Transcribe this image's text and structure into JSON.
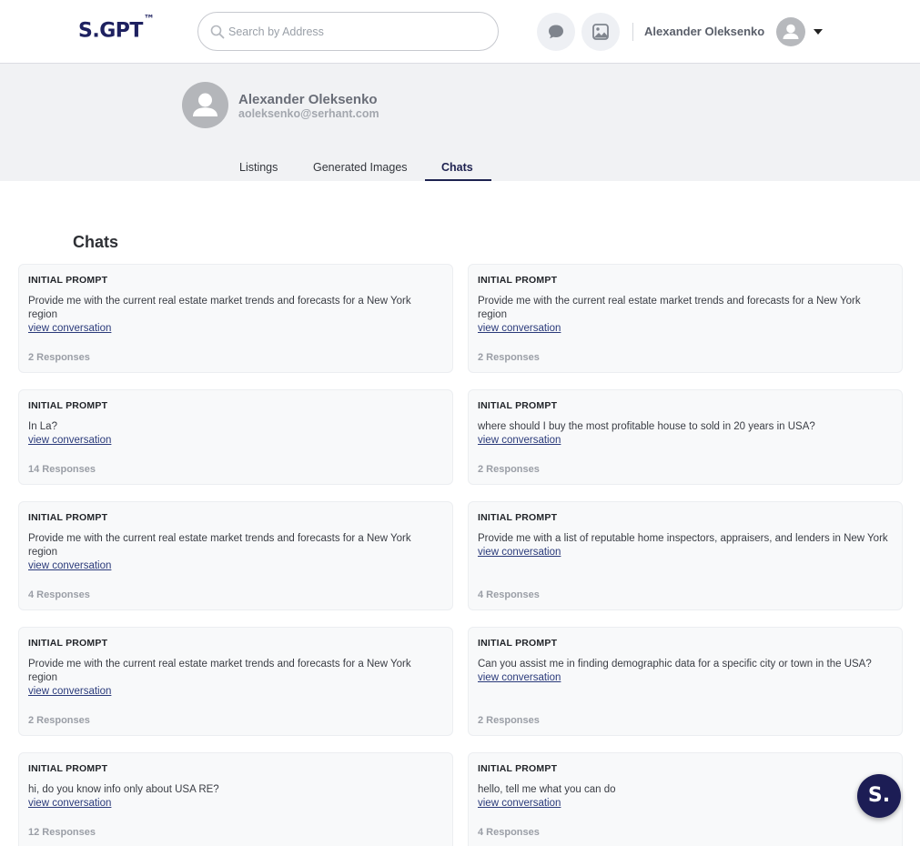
{
  "header": {
    "logo": "S.GPT",
    "logo_mark": "™",
    "search_placeholder": "Search by Address",
    "user_name": "Alexander Oleksenko"
  },
  "profile": {
    "name": "Alexander Oleksenko",
    "email": "aoleksenko@serhant.com"
  },
  "tabs": [
    {
      "label": "Listings"
    },
    {
      "label": "Generated Images"
    },
    {
      "label": "Chats",
      "active": true
    }
  ],
  "section_title": "Chats",
  "chats": [
    {
      "label": "INITIAL PROMPT",
      "prompt": "Provide me with the current real estate market trends and forecasts for a New York region",
      "link": "view conversation",
      "responses": "2 Responses"
    },
    {
      "label": "INITIAL PROMPT",
      "prompt": "Provide me with the current real estate market trends and forecasts for a New York region",
      "link": "view conversation",
      "responses": "2 Responses"
    },
    {
      "label": "INITIAL PROMPT",
      "prompt": "In La?",
      "link": "view conversation",
      "responses": "14 Responses"
    },
    {
      "label": "INITIAL PROMPT",
      "prompt": "where should I buy the most profitable house to sold in 20 years in USA?",
      "link": "view conversation",
      "responses": "2 Responses"
    },
    {
      "label": "INITIAL PROMPT",
      "prompt": "Provide me with the current real estate market trends and forecasts for a New York region",
      "link": "view conversation",
      "responses": "4 Responses"
    },
    {
      "label": "INITIAL PROMPT",
      "prompt": "Provide me with a list of reputable home inspectors, appraisers, and lenders in New York",
      "link": "view conversation",
      "responses": "4 Responses"
    },
    {
      "label": "INITIAL PROMPT",
      "prompt": "Provide me with the current real estate market trends and forecasts for a New York region",
      "link": "view conversation",
      "responses": "2 Responses"
    },
    {
      "label": "INITIAL PROMPT",
      "prompt": "Can you assist me in finding demographic data for a specific city or town in the USA?",
      "link": "view conversation",
      "responses": "2 Responses"
    },
    {
      "label": "INITIAL PROMPT",
      "prompt": "hi, do you know info only about USA RE?",
      "link": "view conversation",
      "responses": "12 Responses"
    },
    {
      "label": "INITIAL PROMPT",
      "prompt": "hello, tell me what you can do",
      "link": "view conversation",
      "responses": "4 Responses"
    }
  ],
  "fab": {
    "label": "S."
  },
  "icons": [
    "search-icon",
    "chat-icon",
    "image-icon",
    "user-avatar-icon",
    "chevron-down-icon"
  ]
}
